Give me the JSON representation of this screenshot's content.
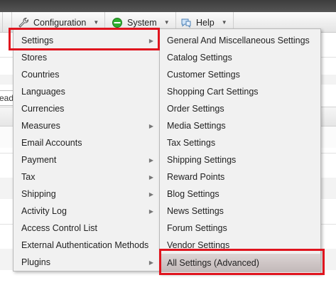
{
  "menubar": {
    "items": [
      {
        "label": "Configuration",
        "icon": "wrench-icon"
      },
      {
        "label": "System",
        "icon": "green-circle-icon"
      },
      {
        "label": "Help",
        "icon": "help-chat-icon"
      }
    ]
  },
  "background": {
    "input_fragment": "eade"
  },
  "left_menu": [
    {
      "label": "Settings",
      "submenu": true
    },
    {
      "label": "Stores",
      "submenu": false
    },
    {
      "label": "Countries",
      "submenu": false
    },
    {
      "label": "Languages",
      "submenu": false
    },
    {
      "label": "Currencies",
      "submenu": false
    },
    {
      "label": "Measures",
      "submenu": true
    },
    {
      "label": "Email Accounts",
      "submenu": false
    },
    {
      "label": "Payment",
      "submenu": true
    },
    {
      "label": "Tax",
      "submenu": true
    },
    {
      "label": "Shipping",
      "submenu": true
    },
    {
      "label": "Activity Log",
      "submenu": true
    },
    {
      "label": "Access Control List",
      "submenu": false
    },
    {
      "label": "External Authentication Methods",
      "submenu": false
    },
    {
      "label": "Plugins",
      "submenu": true
    }
  ],
  "right_menu": [
    "General And Miscellaneous Settings",
    "Catalog Settings",
    "Customer Settings",
    "Shopping Cart Settings",
    "Order Settings",
    "Media Settings",
    "Tax Settings",
    "Shipping Settings",
    "Reward Points",
    "Blog Settings",
    "News Settings",
    "Forum Settings",
    "Vendor Settings",
    "All Settings (Advanced)"
  ],
  "colors": {
    "highlight_border": "#e0141e",
    "menu_bg": "#f1f1f1"
  }
}
